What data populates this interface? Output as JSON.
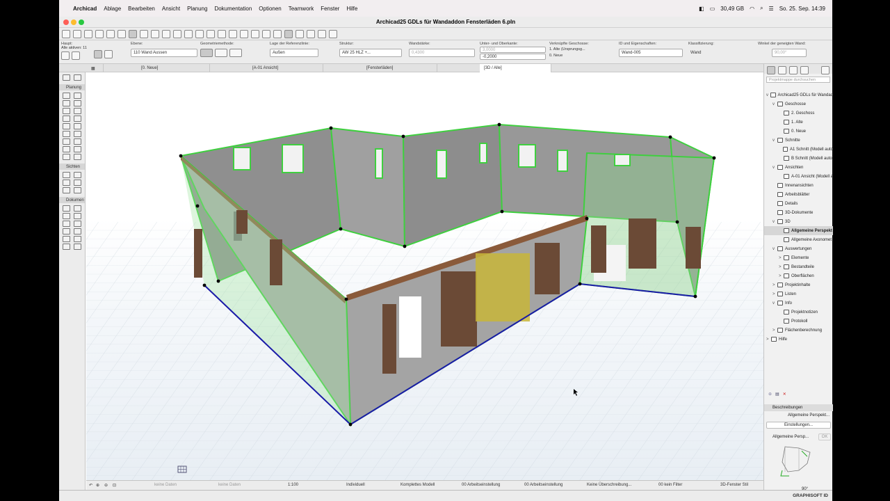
{
  "menubar": {
    "app": "Archicad",
    "items": [
      "Ablage",
      "Bearbeiten",
      "Ansicht",
      "Planung",
      "Dokumentation",
      "Optionen",
      "Teamwork",
      "Fenster",
      "Hilfe"
    ],
    "storage": "30,49 GB",
    "clock": "So. 25. Sep.  14:39"
  },
  "window": {
    "title": "Archicad25 GDLs für Wandaddon Fensterläden 6.pln"
  },
  "infobox": {
    "haupt_label": "Haupt:",
    "alle_aktiven": "Alle aktiven: 11",
    "ebene_label": "Ebene:",
    "ebene_value": "110 Wand Aussen",
    "geometrie_label": "Geometriemethode:",
    "referenz_label": "Lage der Referenzlinie:",
    "referenz_value": "Außen",
    "struktur_label": "Struktur:",
    "struktur_value": "AW 25 HLZ +...",
    "wandstaerke_label": "Wandstärke:",
    "wandstaerke_value": "0,4300",
    "unter_ober_label": "Unter- und Oberkante:",
    "oberkante_value": "3,0000",
    "unterkante_value": "-0,2000",
    "geschosse_label": "Verknüpfte Geschosse:",
    "geschoss_oben": "1. Alte (Ursprungsg...",
    "geschoss_unten": "0. Neue",
    "id_label": "ID und Eigenschaften:",
    "id_value": "Wand-005",
    "klass_label": "Klassifizierung:",
    "klass_value": "Wand",
    "winkel_label": "Winkel der geneigten Wand:",
    "winkel_value": "90,00°"
  },
  "tabs": [
    {
      "label": "[0. Neue]"
    },
    {
      "label": "[A-01 Ansicht]"
    },
    {
      "label": "[Fensterläden]"
    },
    {
      "label": "[3D / Alle]"
    }
  ],
  "toolbox": {
    "sections": [
      "Planung",
      "Sichten",
      "Dokumen"
    ]
  },
  "navigator": {
    "search_placeholder": "Projektmappe durchsuchen",
    "tree": [
      {
        "label": "Archicad25 GDLs für Wandad",
        "level": 0,
        "caret": "v"
      },
      {
        "label": "Geschosse",
        "level": 1,
        "caret": "v"
      },
      {
        "label": "2. Geschoss",
        "level": 2,
        "caret": ""
      },
      {
        "label": "1. Alte",
        "level": 2,
        "caret": ""
      },
      {
        "label": "0. Neue",
        "level": 2,
        "caret": ""
      },
      {
        "label": "Schnitte",
        "level": 1,
        "caret": "v"
      },
      {
        "label": "A1 Schnitt (Modell auto",
        "level": 2,
        "caret": ""
      },
      {
        "label": "B Schnitt (Modell auto",
        "level": 2,
        "caret": ""
      },
      {
        "label": "Ansichten",
        "level": 1,
        "caret": "v"
      },
      {
        "label": "A-01 Ansicht (Modell a",
        "level": 2,
        "caret": ""
      },
      {
        "label": "Innenansichten",
        "level": 1,
        "caret": ""
      },
      {
        "label": "Arbeitsblätter",
        "level": 1,
        "caret": ""
      },
      {
        "label": "Details",
        "level": 1,
        "caret": ""
      },
      {
        "label": "3D-Dokumente",
        "level": 1,
        "caret": ""
      },
      {
        "label": "3D",
        "level": 1,
        "caret": "v"
      },
      {
        "label": "Allgemeine Perspekt",
        "level": 2,
        "caret": "",
        "selected": true
      },
      {
        "label": "Allgemeine Axonomet",
        "level": 2,
        "caret": ""
      },
      {
        "label": "Auswertungen",
        "level": 1,
        "caret": "v"
      },
      {
        "label": "Elemente",
        "level": 2,
        "caret": ">"
      },
      {
        "label": "Bestandteile",
        "level": 2,
        "caret": ">"
      },
      {
        "label": "Oberflächen",
        "level": 2,
        "caret": ">"
      },
      {
        "label": "Projektinhalte",
        "level": 1,
        "caret": ">"
      },
      {
        "label": "Listen",
        "level": 1,
        "caret": ">"
      },
      {
        "label": "Info",
        "level": 1,
        "caret": "v"
      },
      {
        "label": "Projektnotizen",
        "level": 2,
        "caret": ""
      },
      {
        "label": "Protokoll",
        "level": 2,
        "caret": ""
      },
      {
        "label": "Flächenberechnung",
        "level": 1,
        "caret": ">"
      },
      {
        "label": "Hilfe",
        "level": 0,
        "caret": ">"
      }
    ],
    "beschreibungen_label": "Beschreibungen",
    "beschreibung_value": "Allgemeine Perspekt...",
    "einstellungen_label": "Einstellungen...",
    "preview_label": "Allgemeine Persp...",
    "ok_label": "OK",
    "angle": "90°",
    "brand": "GRAPHISOFT ID"
  },
  "statusbar": {
    "keine_daten_1": "keine Daten",
    "keine_daten_2": "keine Daten",
    "scale": "1:100",
    "individuell": "Individuell",
    "modell": "Komplettes Modell",
    "arbeitseinstellung_1": "00 Arbeitseinstellung",
    "arbeitseinstellung_2": "00 Arbeitseinstellung",
    "ueberschreibung": "Keine Überschreibung...",
    "filter": "00 kein Filter",
    "stil": "3D-Fenster Stil"
  },
  "colors": {
    "accent_green": "#3fcf3f",
    "wall_gray": "#9a9a9a",
    "shutter_brown": "#6b4a36",
    "selection_blue": "#1a1aa8"
  }
}
